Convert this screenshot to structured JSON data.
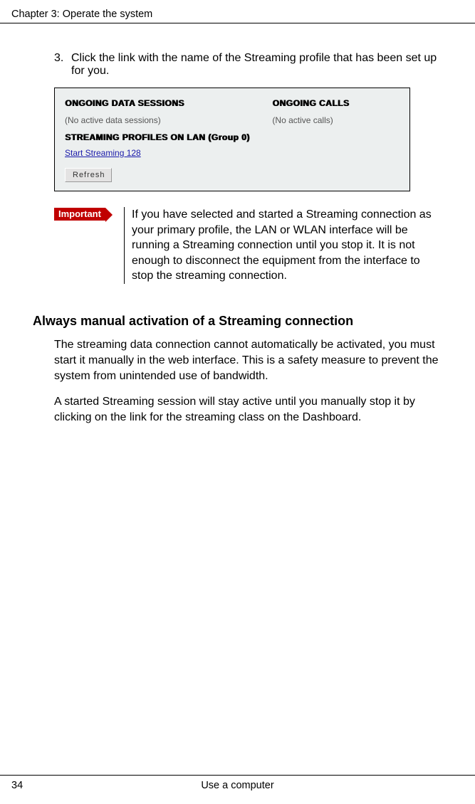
{
  "header": {
    "chapter_title": "Chapter 3:  Operate the system"
  },
  "step": {
    "number": "3.",
    "text": "Click the link with the name of the Streaming profile that has been set up for you."
  },
  "figure": {
    "heading_sessions": "ONGOING DATA SESSIONS",
    "heading_calls": "ONGOING CALLS",
    "no_sessions": "(No active data sessions)",
    "no_calls": "(No active calls)",
    "heading_profiles": "STREAMING PROFILES ON LAN  (Group 0)",
    "link_label": "Start Streaming 128",
    "refresh_label": "Refresh"
  },
  "note": {
    "tag": "Important",
    "text": "If you have selected and started a Streaming connection as your primary profile, the LAN or WLAN interface will be running a Streaming connection until you stop it. It is not enough to disconnect the equipment from the interface to stop the streaming connection."
  },
  "section_heading": "Always manual activation of a Streaming connection",
  "para1": "The streaming data connection cannot automatically be activated, you must start it manually in the web interface. This is a safety measure to prevent the system from unintended use of bandwidth.",
  "para2": "A started Streaming session will stay active until you manually stop it by clicking on the link for the streaming class on the Dashboard.",
  "footer": {
    "page_number": "34",
    "section": "Use a computer"
  }
}
